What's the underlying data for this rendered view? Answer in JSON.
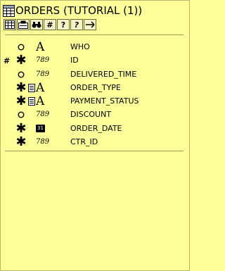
{
  "window": {
    "title": "ORDERS (TUTORIAL (1))"
  },
  "toolbar": {
    "buttons": [
      {
        "name": "table-icon",
        "label": ""
      },
      {
        "name": "entity-icon",
        "label": ""
      },
      {
        "name": "binoculars-icon",
        "label": ""
      },
      {
        "name": "hash-icon",
        "label": "#"
      },
      {
        "name": "help-icon",
        "label": "?"
      },
      {
        "name": "help-arrow-icon",
        "label": "?"
      },
      {
        "name": "relation-icon",
        "label": ""
      }
    ]
  },
  "columns": [
    {
      "name": "WHO",
      "key": "",
      "mandatory": "optional",
      "type": "text",
      "extended": false
    },
    {
      "name": "ID",
      "key": "#",
      "mandatory": "mandatory",
      "type": "number",
      "extended": false
    },
    {
      "name": "DELIVERED_TIME",
      "key": "",
      "mandatory": "optional",
      "type": "number",
      "extended": false
    },
    {
      "name": "ORDER_TYPE",
      "key": "",
      "mandatory": "mandatory",
      "type": "text",
      "extended": true
    },
    {
      "name": "PAYMENT_STATUS",
      "key": "",
      "mandatory": "mandatory",
      "type": "text",
      "extended": true
    },
    {
      "name": "DISCOUNT",
      "key": "",
      "mandatory": "optional",
      "type": "number",
      "extended": false
    },
    {
      "name": "ORDER_DATE",
      "key": "",
      "mandatory": "mandatory",
      "type": "date",
      "extended": false
    },
    {
      "name": "CTR_ID",
      "key": "",
      "mandatory": "mandatory",
      "type": "number",
      "extended": false
    }
  ],
  "glyphs": {
    "text_type": "A",
    "number_type": "789",
    "date_type": "31",
    "mandatory": "✱",
    "optional": "o"
  },
  "colors": {
    "background": "#ffff99",
    "border": "#b8b86a"
  }
}
